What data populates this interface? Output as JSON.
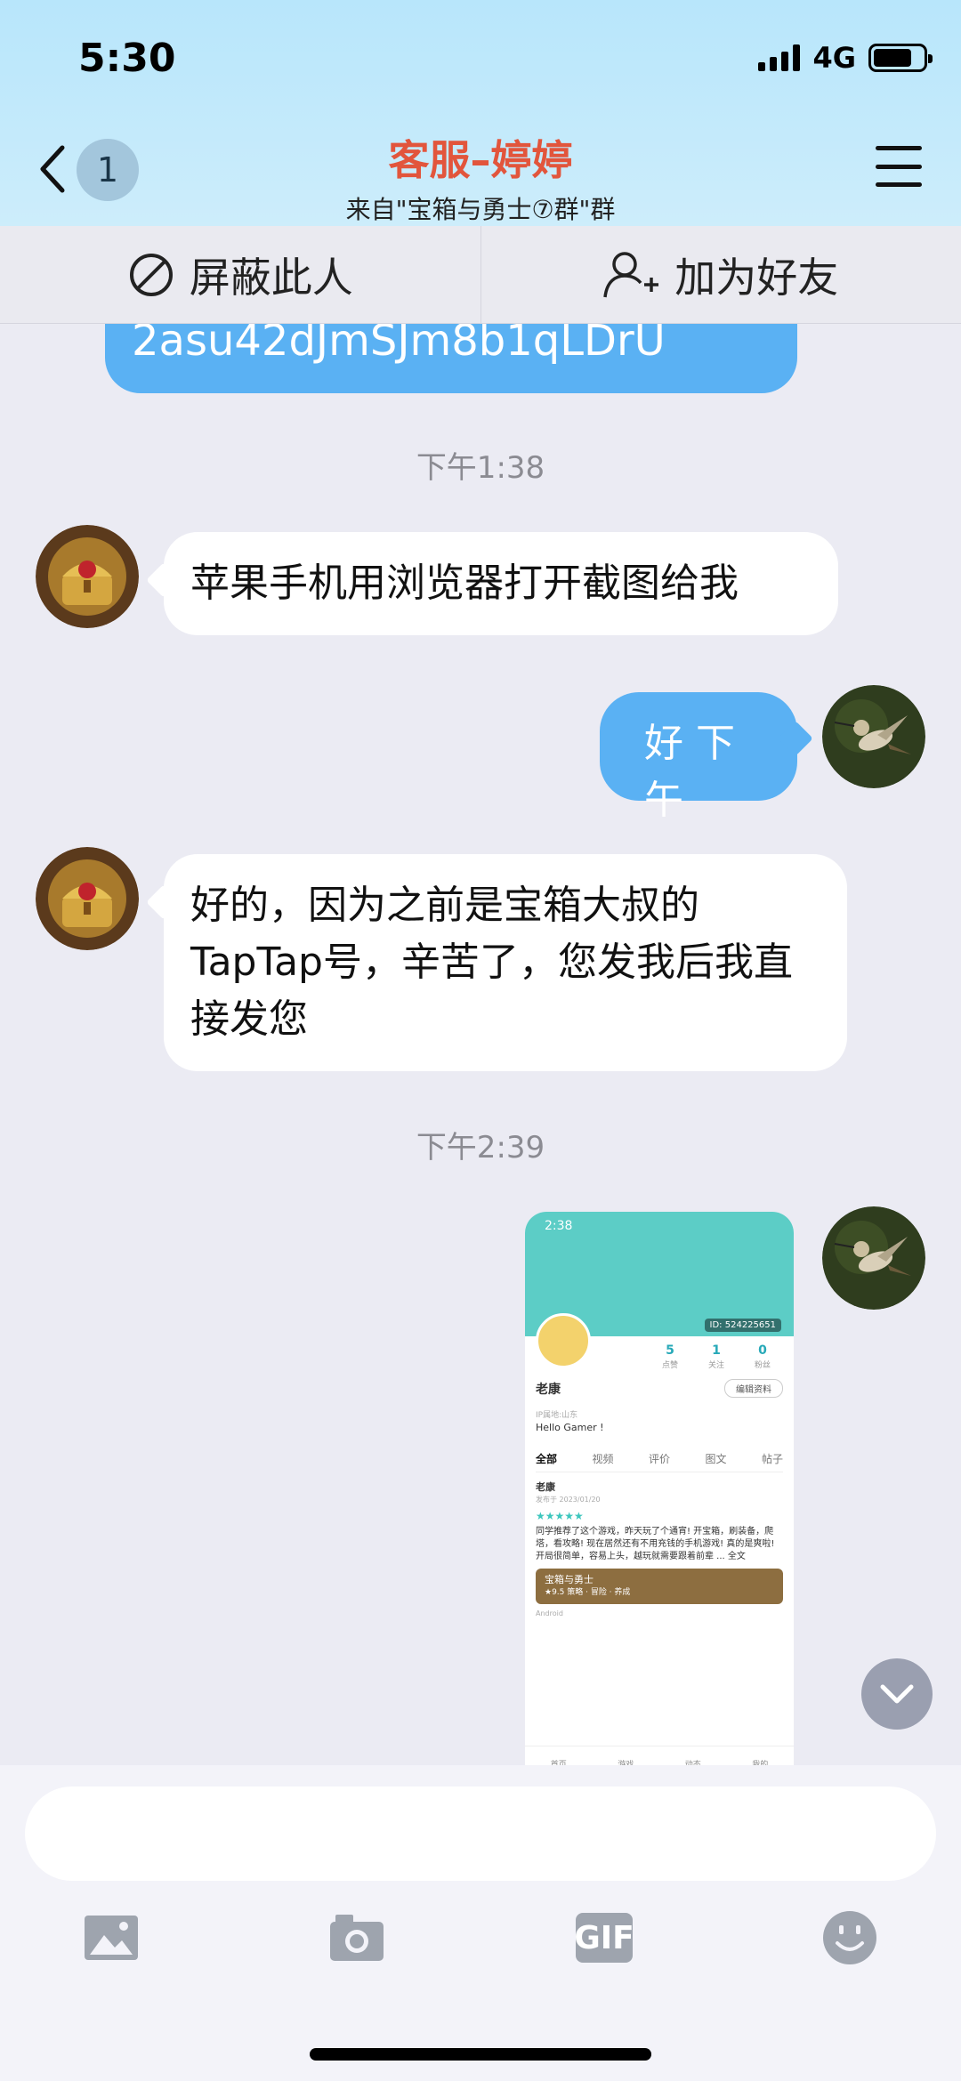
{
  "status_bar": {
    "time": "5:30",
    "network": "4G"
  },
  "header": {
    "back_badge": "1",
    "title": "客服–婷婷",
    "subtitle": "来自\"宝箱与勇士⑦群\"群"
  },
  "actions": {
    "block": "屏蔽此人",
    "add_friend": "加为好友"
  },
  "chat": {
    "cut_message": "2asu42dJmSJm8b1qLDrU",
    "time1": "下午1:38",
    "msg1": "苹果手机用浏览器打开截图给我",
    "msg2": "好 下午",
    "msg3": "好的，因为之前是宝箱大叔的TapTap号，辛苦了，您发我后我直接发您",
    "time2": "下午2:39"
  },
  "screenshot": {
    "time": "2:38",
    "id": "ID: 524225651",
    "stats": [
      {
        "value": "5",
        "label": "点赞"
      },
      {
        "value": "1",
        "label": "关注"
      },
      {
        "value": "0",
        "label": "粉丝"
      }
    ],
    "name": "老康",
    "edit": "编辑资料",
    "location": "IP属地:山东",
    "hello": "Hello Gamer !",
    "tabs": [
      "全部",
      "视频",
      "评价",
      "图文",
      "帖子"
    ],
    "post_name": "老康",
    "post_date": "发布于 2023/01/20",
    "stars": "★★★★★",
    "post_text": "同学推荐了这个游戏，昨天玩了个通宵! 开宝箱，刷装备，爬塔，看攻略! 现在居然还有不用充钱的手机游戏! 真的是爽啦! 开局很简单，容易上头，越玩就需要跟着前辈 ... 全文",
    "game": "宝箱与勇士",
    "game_meta": "★9.5 策略 · 冒险 · 养成",
    "platform": "Android",
    "nav": [
      "首页",
      "游戏",
      "动态",
      "我的"
    ]
  },
  "input": {
    "placeholder": ""
  },
  "toolbar": {
    "gif": "GIF"
  },
  "colors": {
    "accent": "#5ab1f3",
    "title": "#e2553c",
    "header_bg": "#c4eafb"
  }
}
